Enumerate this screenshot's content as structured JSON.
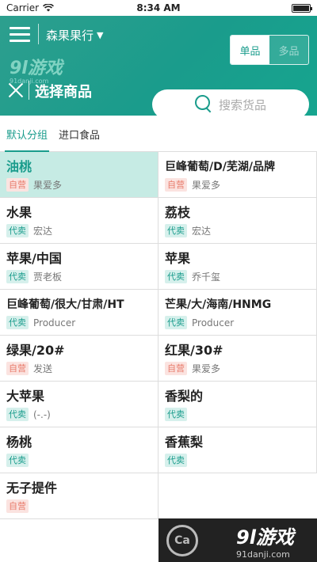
{
  "status": {
    "carrier": "Carrier",
    "time": "8:34 AM"
  },
  "header": {
    "store_name": "森果果行",
    "segment": {
      "single": "单品",
      "multi": "多品"
    },
    "watermark_big": "9l游戏",
    "watermark_small": "91danji.com",
    "title": "选择商品",
    "search_placeholder": "搜索货品"
  },
  "tabs": [
    {
      "label": "默认分组",
      "active": true
    },
    {
      "label": "进口食品",
      "active": false
    }
  ],
  "products": [
    {
      "name": "油桃",
      "badge": "自营",
      "type": "self",
      "vendor": "果爱多",
      "selected": true
    },
    {
      "name": "巨峰葡萄/D/芜湖/品牌",
      "badge": "自营",
      "type": "self",
      "vendor": "果爱多",
      "small": true
    },
    {
      "name": "水果",
      "badge": "代卖",
      "type": "agent",
      "vendor": "宏达"
    },
    {
      "name": "荔枝",
      "badge": "代卖",
      "type": "agent",
      "vendor": "宏达"
    },
    {
      "name": "苹果/中国",
      "badge": "代卖",
      "type": "agent",
      "vendor": "贾老板"
    },
    {
      "name": "苹果",
      "badge": "代卖",
      "type": "agent",
      "vendor": "乔千玺"
    },
    {
      "name": "巨峰葡萄/很大/甘肃/HT",
      "badge": "代卖",
      "type": "agent",
      "vendor": "Producer",
      "small": true
    },
    {
      "name": "芒果/大/海南/HNMG",
      "badge": "代卖",
      "type": "agent",
      "vendor": "Producer",
      "small": true
    },
    {
      "name": "绿果/20#",
      "badge": "自营",
      "type": "self",
      "vendor": "发送"
    },
    {
      "name": "红果/30#",
      "badge": "自营",
      "type": "self",
      "vendor": "果爱多"
    },
    {
      "name": "大苹果",
      "badge": "代卖",
      "type": "agent",
      "vendor": "(-.-)"
    },
    {
      "name": "香梨的",
      "badge": "代卖",
      "type": "agent",
      "vendor": ""
    },
    {
      "name": "杨桃",
      "badge": "代卖",
      "type": "agent",
      "vendor": ""
    },
    {
      "name": "香蕉梨",
      "badge": "代卖",
      "type": "agent",
      "vendor": ""
    },
    {
      "name": "无子提件",
      "badge": "自营",
      "type": "self",
      "vendor": ""
    }
  ],
  "watermark_bottom": {
    "brand": "9l游戏",
    "site": "91danji.com",
    "circle_text": "Ca"
  },
  "colors": {
    "accent": "#1a9c8c",
    "selected_bg": "#c6ebe4",
    "self_badge": "#e87c6c",
    "agent_badge": "#1a9c8c"
  }
}
